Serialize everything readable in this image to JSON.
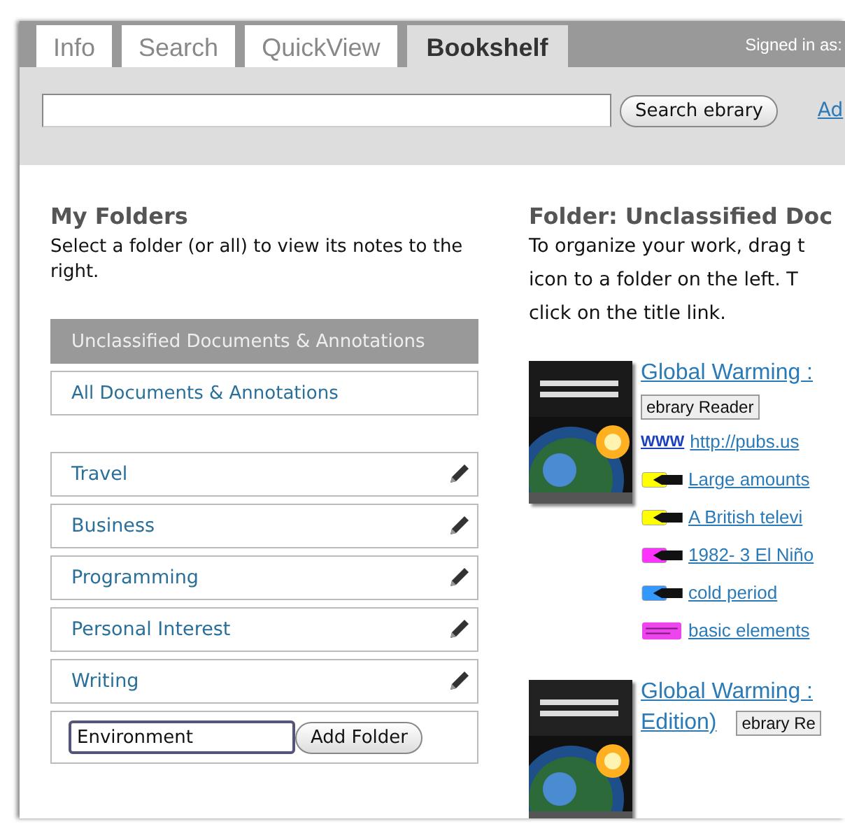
{
  "tabs": [
    {
      "label": "Info",
      "selected": false
    },
    {
      "label": "Search",
      "selected": false
    },
    {
      "label": "QuickView",
      "selected": false
    },
    {
      "label": "Bookshelf",
      "selected": true
    }
  ],
  "signed_in": "Signed in as:",
  "search": {
    "button": "Search ebrary",
    "link": "Ad"
  },
  "my_folders": {
    "title": "My Folders",
    "description": "Select a folder (or all) to view its notes to the right.",
    "folders": [
      {
        "label": "Unclassified Documents & Annotations",
        "selected": true
      },
      {
        "label": "All Documents & Annotations",
        "selected": false
      }
    ],
    "custom_folders": [
      {
        "label": "Travel"
      },
      {
        "label": "Business"
      },
      {
        "label": "Programming"
      },
      {
        "label": "Personal Interest"
      },
      {
        "label": "Writing"
      }
    ],
    "new_folder": {
      "value": "Environment",
      "button": "Add Folder"
    }
  },
  "folder": {
    "title": "Folder: Unclassified Doc",
    "instructions": [
      "To organize your work, drag t",
      "icon to a folder on the left. T",
      "click on the title link."
    ],
    "documents": [
      {
        "title_lines": [
          "Global Warming :"
        ],
        "reader_button": "ebrary Reader",
        "button_inline": false,
        "annotations": [
          {
            "kind": "link",
            "icon": "WWW",
            "text": "http://pubs.us"
          },
          {
            "kind": "highlight",
            "color": "#ffff00",
            "text": "Large amounts"
          },
          {
            "kind": "highlight",
            "color": "#ffff00",
            "text": "A British televi"
          },
          {
            "kind": "highlight",
            "color": "#ff33ff",
            "text": "1982- 3 El Niño"
          },
          {
            "kind": "highlight",
            "color": "#3399ff",
            "text": "cold period"
          },
          {
            "kind": "note",
            "color": "#ee44ee",
            "text": "basic elements"
          }
        ]
      },
      {
        "title_lines": [
          "Global Warming :",
          "Edition)"
        ],
        "reader_button": "ebrary Re",
        "button_inline": true
      }
    ]
  }
}
